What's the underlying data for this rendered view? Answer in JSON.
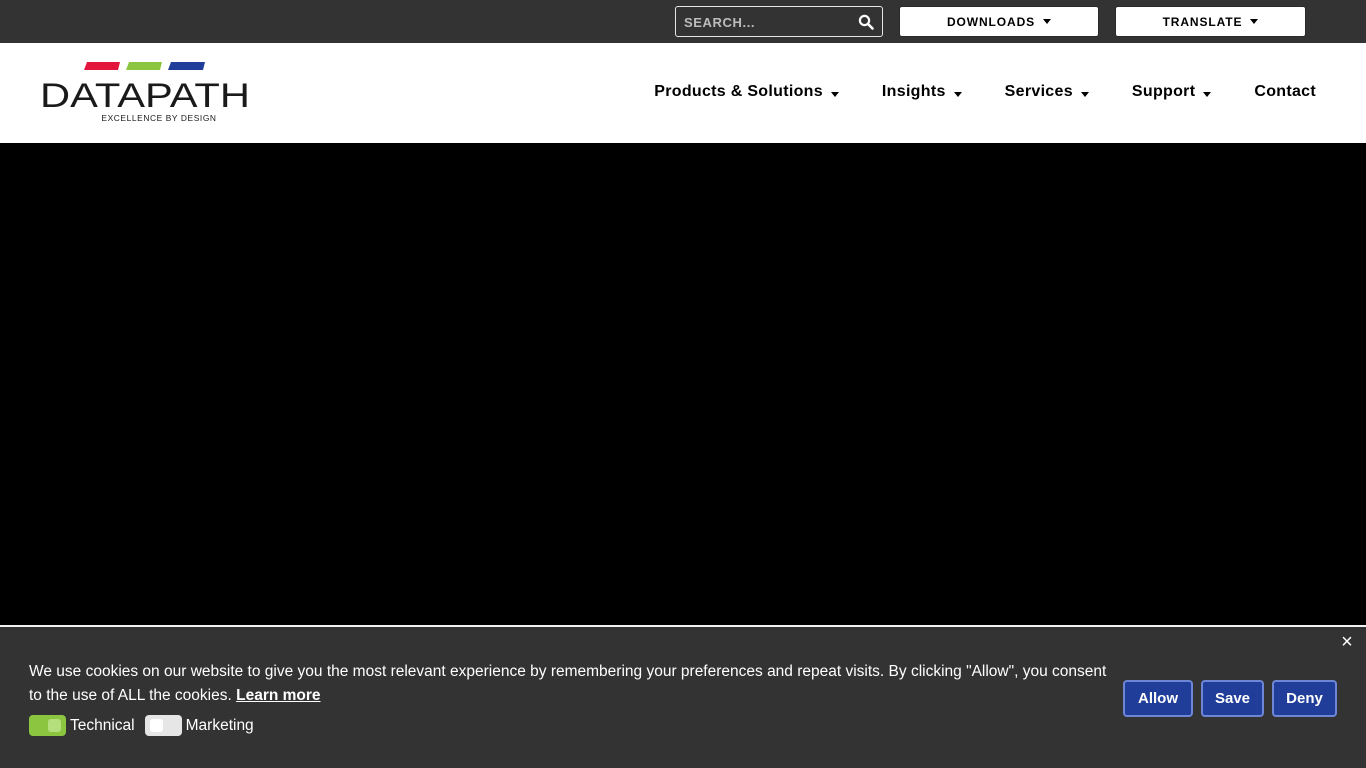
{
  "topbar": {
    "search": {
      "placeholder": "SEARCH..."
    },
    "downloads_label": "DOWNLOADS",
    "translate_label": "TRANSLATE"
  },
  "brand": {
    "name": "DATAPATH",
    "tagline": "EXCELLENCE BY DESIGN",
    "stripe_colors": [
      "#e3173e",
      "#8cc640",
      "#1f3d99"
    ]
  },
  "nav": {
    "items": [
      {
        "label": "Products & Solutions",
        "has_dropdown": true
      },
      {
        "label": "Insights",
        "has_dropdown": true
      },
      {
        "label": "Services",
        "has_dropdown": true
      },
      {
        "label": "Support",
        "has_dropdown": true
      },
      {
        "label": "Contact",
        "has_dropdown": false
      }
    ]
  },
  "cookie": {
    "message": "We use cookies on our website to give you the most relevant experience by remembering your preferences and repeat visits. By clicking \"Allow\", you consent to the use of ALL the cookies.",
    "learn_more": "Learn more",
    "toggles": [
      {
        "label": "Technical",
        "on": true
      },
      {
        "label": "Marketing",
        "on": false
      }
    ],
    "buttons": {
      "allow": "Allow",
      "save": "Save",
      "deny": "Deny"
    },
    "close_symbol": "×"
  },
  "colors": {
    "topbar_bg": "#333333",
    "cookie_bg": "#333333",
    "button_blue": "#1f3d99",
    "toggle_on": "#8cc640"
  }
}
